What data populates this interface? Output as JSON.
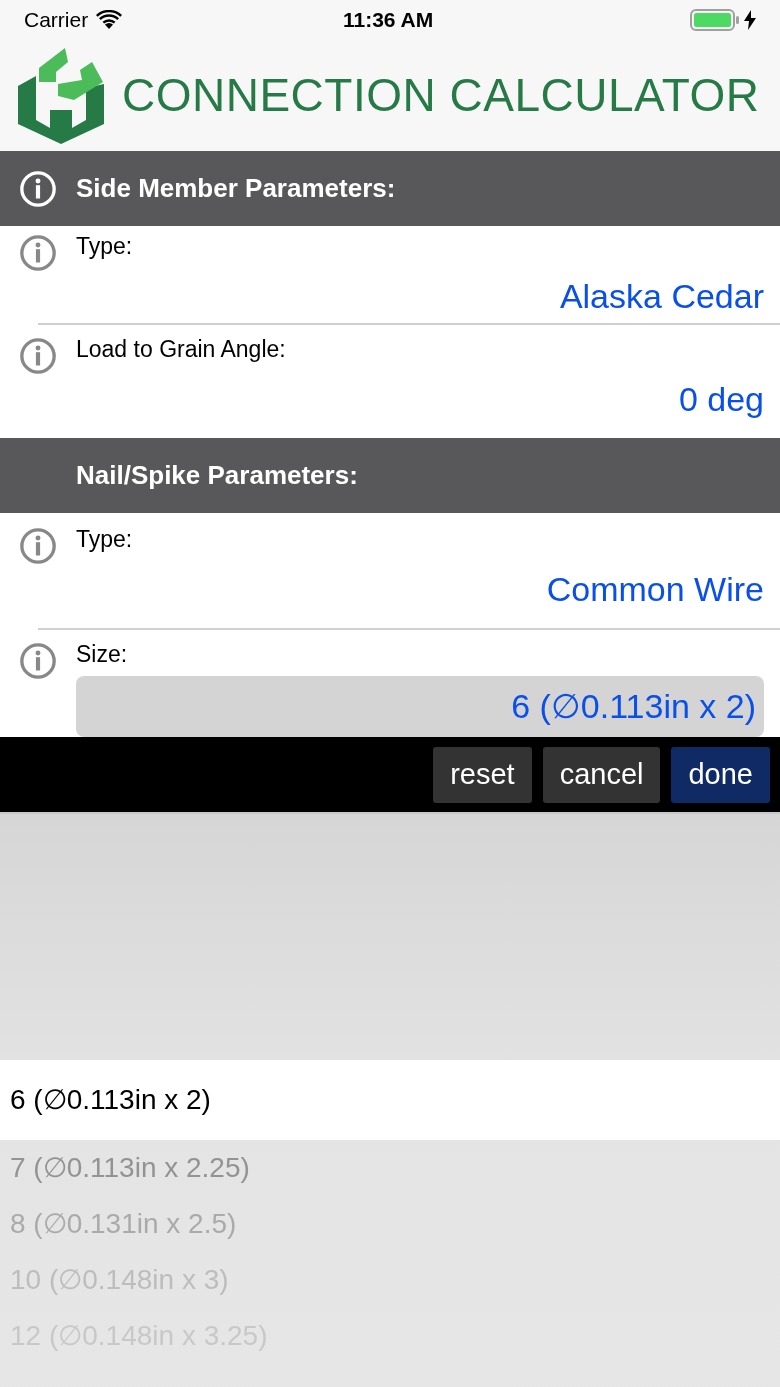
{
  "status_bar": {
    "carrier": "Carrier",
    "time": "11:36 AM",
    "battery_charging": true
  },
  "app_header": {
    "title": "CONNECTION CALCULATOR"
  },
  "sections": [
    {
      "title": "Side Member Parameters:",
      "has_info": true,
      "rows": [
        {
          "label": "Type:",
          "value": "Alaska Cedar",
          "kind": "text"
        },
        {
          "label": "Load to Grain Angle:",
          "value": "0 deg",
          "kind": "text"
        }
      ]
    },
    {
      "title": "Nail/Spike Parameters:",
      "has_info": false,
      "rows": [
        {
          "label": "Type:",
          "value": "Common Wire",
          "kind": "text"
        },
        {
          "label": "Size:",
          "value": "6 (∅0.113in x 2)",
          "kind": "field"
        }
      ]
    }
  ],
  "toolbar": {
    "buttons": [
      {
        "label": "reset",
        "kind": "plain"
      },
      {
        "label": "cancel",
        "kind": "plain"
      },
      {
        "label": "done",
        "kind": "primary"
      }
    ]
  },
  "picker": {
    "options": [
      {
        "label": "6 (∅0.113in x 2)",
        "selected": true
      },
      {
        "label": "7 (∅0.113in x 2.25)",
        "selected": false
      },
      {
        "label": "8 (∅0.131in x 2.5)",
        "selected": false
      },
      {
        "label": "10 (∅0.148in x 3)",
        "selected": false
      },
      {
        "label": "12 (∅0.148in x 3.25)",
        "selected": false
      }
    ]
  }
}
